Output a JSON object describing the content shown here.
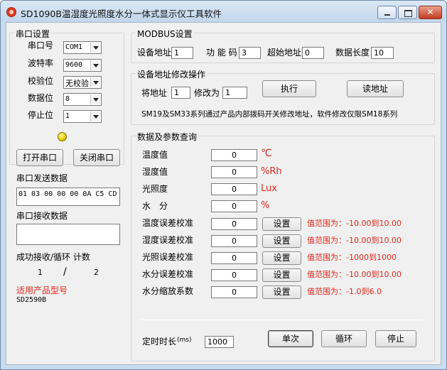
{
  "window": {
    "title": "SD1090B温湿度光照度水分一体式显示仪工具软件",
    "minimize_label": "",
    "maximize_label": "",
    "close_label": "✕"
  },
  "serial": {
    "group_title": "串口设置",
    "port_label": "串口号",
    "port_value": "COM1",
    "baud_label": "波特率",
    "baud_value": "9600",
    "parity_label": "校验位",
    "parity_value": "无校验",
    "databits_label": "数据位",
    "databits_value": "8",
    "stopbits_label": "停止位",
    "stopbits_value": "1",
    "open_button": "打开串口",
    "close_button": "关闭串口",
    "send_label": "串口发送数据",
    "send_value": "01 03 00 00 00 0A C5 CD",
    "receive_label": "串口接收数据",
    "receive_value": "",
    "stats_label": "成功接收/循环 计数",
    "success_count": "1",
    "separator": "/",
    "loop_count": "2",
    "product_label": "适用产品型号",
    "product_value": "SD2590B"
  },
  "modbus": {
    "group_title": "MODBUS设置",
    "address_label": "设备地址",
    "address_value": "1",
    "function_label": "功 能 码",
    "function_value": "3",
    "start_label": "超始地址",
    "start_value": "0",
    "length_label": "数据长度",
    "length_value": "10"
  },
  "addr_change": {
    "group_title": "设备地址修改操作",
    "from_label": "将地址",
    "from_value": "1",
    "to_label": "修改为",
    "to_value": "1",
    "execute_button": "执行",
    "read_button": "读地址",
    "note": "SM19及SM33系列通过产品内部拨码开关修改地址，软件修改仅限SM18系列"
  },
  "query": {
    "group_title": "数据及参数查询",
    "rows": [
      {
        "label": "温度值",
        "value": "0",
        "unit": "℃"
      },
      {
        "label": "湿度值",
        "value": "0",
        "unit": "%Rh"
      },
      {
        "label": "光照度",
        "value": "0",
        "unit": "Lux"
      },
      {
        "label": "水　分",
        "value": "0",
        "unit": "%"
      },
      {
        "label": "温度误差校准",
        "value": "0",
        "button": "设置",
        "range": "值范围为：-10.00到10.00"
      },
      {
        "label": "湿度误差校准",
        "value": "0",
        "button": "设置",
        "range": "值范围为：-10.00到10.00"
      },
      {
        "label": "光照误差校准",
        "value": "0",
        "button": "设置",
        "range": "值范围为：-1000到1000"
      },
      {
        "label": "水分误差校准",
        "value": "0",
        "button": "设置",
        "range": "值范围为：-10.00到10.00"
      },
      {
        "label": "水分缩放系数",
        "value": "0",
        "button": "设置",
        "range": "值范围为：-1.0到6.0"
      }
    ],
    "timer_label": "定时时长",
    "timer_unit": "(ms)",
    "timer_value": "1000",
    "single_button": "单次",
    "loop_button": "循环",
    "stop_button": "停止"
  },
  "colors": {
    "accent_red": "#e0281e",
    "led_yellow": "#e8cc00"
  }
}
